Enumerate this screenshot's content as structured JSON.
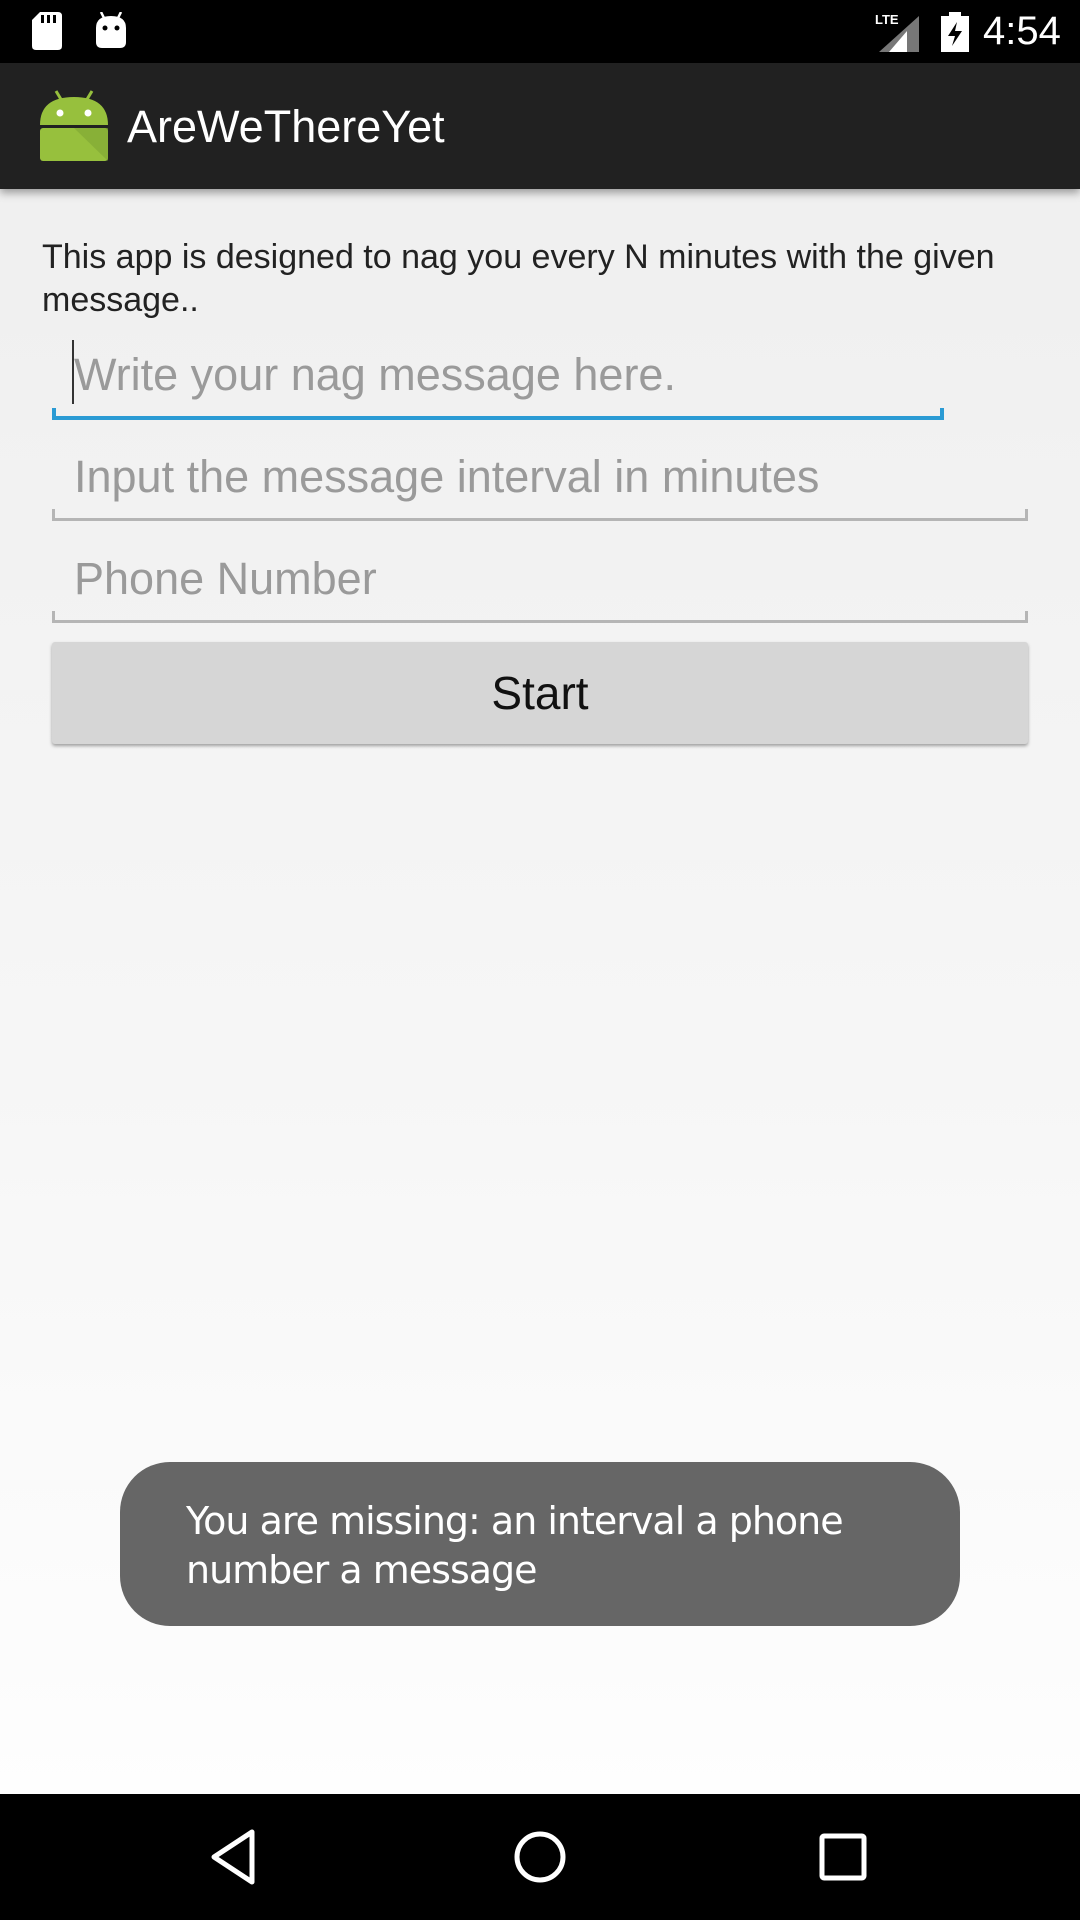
{
  "status_bar": {
    "time": "4:54",
    "network_label": "LTE",
    "icons": [
      "sd-card-icon",
      "android-icon",
      "signal-icon",
      "battery-icon"
    ]
  },
  "action_bar": {
    "title": "AreWeThereYet",
    "icon": "android-app-icon",
    "background_color": "#212121"
  },
  "main": {
    "description": "This app is designed to nag you every N minutes with the given message..",
    "fields": [
      {
        "placeholder": "Write your nag message here.",
        "value": "",
        "focused": true
      },
      {
        "placeholder": "Input the message interval in minutes",
        "value": "",
        "focused": false
      },
      {
        "placeholder": "Phone Number",
        "value": "",
        "focused": false
      }
    ],
    "start_label": "Start"
  },
  "toast": {
    "message": "You are missing: an interval a phone number a message"
  },
  "nav_bar": {
    "buttons": [
      "back-icon",
      "home-icon",
      "recents-icon"
    ]
  },
  "colors": {
    "accent": "#2b9bd4",
    "android_green": "#97c03d"
  }
}
